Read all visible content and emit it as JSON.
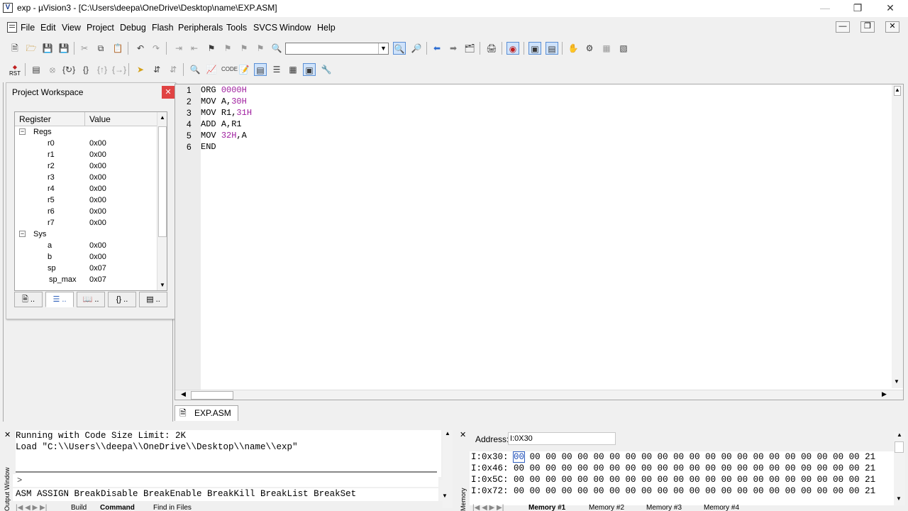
{
  "window": {
    "title": "exp  - µVision3 - [C:\\Users\\deepa\\OneDrive\\Desktop\\name\\EXP.ASM]",
    "app_icon": "V"
  },
  "menu": [
    "File",
    "Edit",
    "View",
    "Project",
    "Debug",
    "Flash",
    "Peripherals",
    "Tools",
    "SVCS",
    "Window",
    "Help"
  ],
  "toolbar2_rst_label": "RST",
  "workspace": {
    "title": "Project Workspace",
    "columns": [
      "Register",
      "Value"
    ],
    "groups": [
      {
        "name": "Regs",
        "rows": [
          {
            "name": "r0",
            "value": "0x00"
          },
          {
            "name": "r1",
            "value": "0x00"
          },
          {
            "name": "r2",
            "value": "0x00"
          },
          {
            "name": "r3",
            "value": "0x00"
          },
          {
            "name": "r4",
            "value": "0x00"
          },
          {
            "name": "r5",
            "value": "0x00"
          },
          {
            "name": "r6",
            "value": "0x00"
          },
          {
            "name": "r7",
            "value": "0x00"
          }
        ]
      },
      {
        "name": "Sys",
        "rows": [
          {
            "name": "a",
            "value": "0x00"
          },
          {
            "name": "b",
            "value": "0x00"
          },
          {
            "name": "sp",
            "value": "0x07"
          },
          {
            "name": "sp_max",
            "value": "0x07"
          }
        ]
      }
    ]
  },
  "editor": {
    "lines": [
      {
        "n": "1",
        "op": "ORG ",
        "args": "",
        "num": "0000H"
      },
      {
        "n": "2",
        "op": "MOV ",
        "args": "A,",
        "num": "30H"
      },
      {
        "n": "3",
        "op": "MOV ",
        "args": "R1,",
        "num": "31H"
      },
      {
        "n": "4",
        "op": "ADD ",
        "args": "A,R1",
        "num": ""
      },
      {
        "n": "5",
        "op": "MOV ",
        "args": "",
        "num": "32H",
        "tail": ",A"
      },
      {
        "n": "6",
        "op": "END",
        "args": "",
        "num": ""
      }
    ],
    "tab_label": "EXP.ASM"
  },
  "output": {
    "lines": [
      "Running with Code Size Limit: 2K",
      "Load \"C:\\\\Users\\\\deepa\\\\OneDrive\\\\Desktop\\\\name\\\\exp\""
    ],
    "prompt": ">",
    "help": "ASM ASSIGN BreakDisable BreakEnable BreakKill BreakList BreakSet",
    "tabs": [
      "Build",
      "Command",
      "Find in Files"
    ],
    "side_label": "Output Window"
  },
  "memory": {
    "address_label": "Address:",
    "address_value": "I:0X30",
    "rows": [
      {
        "addr": "I:0x30:",
        "first": "00",
        "rest": "00 00 00 00 00 00 00 00 00 00 00 00 00 00 00 00 00 00 00 00 00 21"
      },
      {
        "addr": "I:0x46:",
        "first": "",
        "rest": "00 00 00 00 00 00 00 00 00 00 00 00 00 00 00 00 00 00 00 00 00 00 21"
      },
      {
        "addr": "I:0x5C:",
        "first": "",
        "rest": "00 00 00 00 00 00 00 00 00 00 00 00 00 00 00 00 00 00 00 00 00 00 21"
      },
      {
        "addr": "I:0x72:",
        "first": "",
        "rest": "00 00 00 00 00 00 00 00 00 00 00 00 00 00 00 00 00 00 00 00 00 00 21"
      }
    ],
    "tabs": [
      "Memory #1",
      "Memory #2",
      "Memory #3",
      "Memory #4"
    ],
    "side_label": "Memory"
  }
}
